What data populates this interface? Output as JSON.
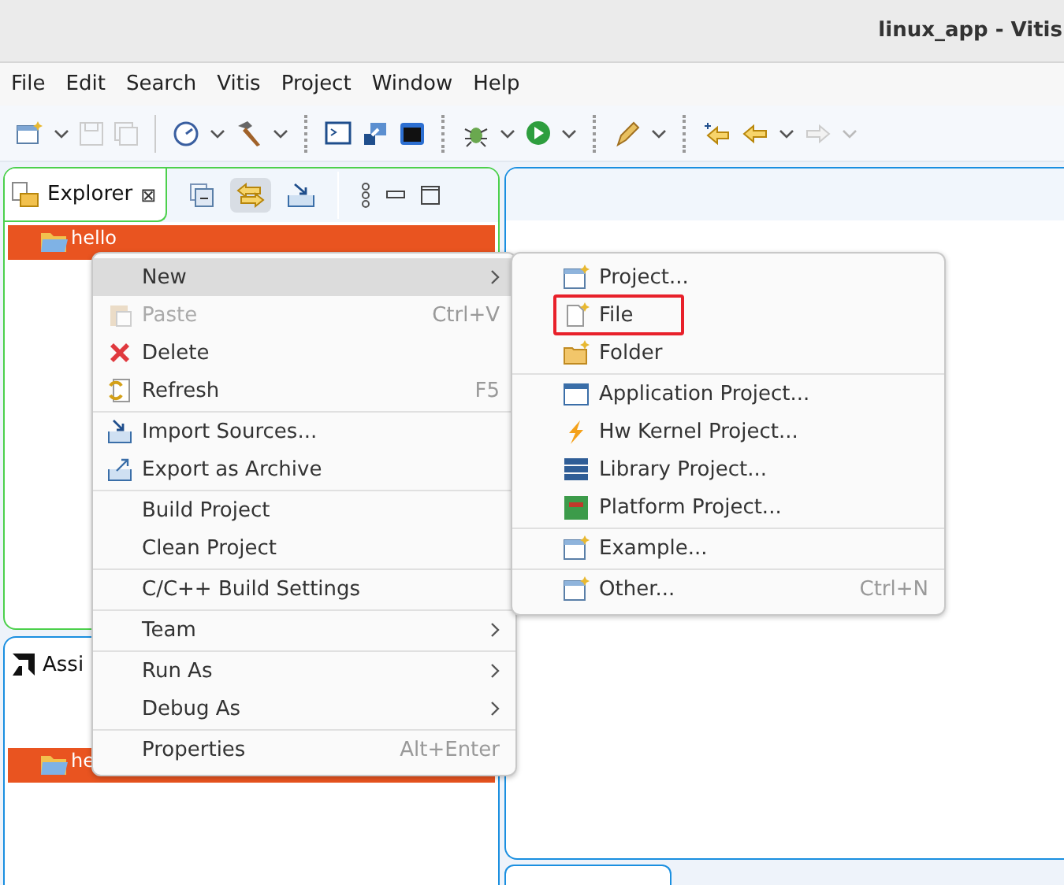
{
  "window": {
    "title": "linux_app - Vitis"
  },
  "menubar": [
    "File",
    "Edit",
    "Search",
    "Vitis",
    "Project",
    "Window",
    "Help"
  ],
  "explorer": {
    "tab": "Explorer",
    "close": "⊠",
    "rows": [
      {
        "label": "hello",
        "selected": true
      }
    ]
  },
  "assistant": {
    "tab": "Assi",
    "rows": [
      {
        "label": "he",
        "selected": true
      }
    ]
  },
  "context_menu": {
    "groups": [
      [
        {
          "label": "New",
          "submenu": true,
          "selected": true,
          "disabled": false
        },
        {
          "label": "Paste",
          "shortcut": "Ctrl+V",
          "selected": false,
          "disabled": true
        },
        {
          "label": "Delete",
          "selected": false,
          "disabled": false
        },
        {
          "label": "Refresh",
          "shortcut": "F5",
          "selected": false,
          "disabled": false
        }
      ],
      [
        {
          "label": "Import Sources...",
          "selected": false,
          "disabled": false
        },
        {
          "label": "Export as Archive",
          "selected": false,
          "disabled": false
        }
      ],
      [
        {
          "label": "Build Project",
          "selected": false,
          "disabled": false
        },
        {
          "label": "Clean Project",
          "selected": false,
          "disabled": false
        }
      ],
      [
        {
          "label": "C/C++ Build Settings",
          "selected": false,
          "disabled": false
        }
      ],
      [
        {
          "label": "Team",
          "submenu": true,
          "selected": false,
          "disabled": false
        }
      ],
      [
        {
          "label": "Run As",
          "submenu": true,
          "selected": false,
          "disabled": false
        },
        {
          "label": "Debug As",
          "submenu": true,
          "selected": false,
          "disabled": false
        }
      ],
      [
        {
          "label": "Properties",
          "shortcut": "Alt+Enter",
          "selected": false,
          "disabled": false
        }
      ]
    ]
  },
  "submenu": {
    "groups": [
      [
        {
          "label": "Project...",
          "marked": false
        },
        {
          "label": "File",
          "marked": true
        },
        {
          "label": "Folder",
          "marked": false
        }
      ],
      [
        {
          "label": "Application Project...",
          "marked": false
        },
        {
          "label": "Hw Kernel Project...",
          "marked": false
        },
        {
          "label": "Library Project...",
          "marked": false
        },
        {
          "label": "Platform Project...",
          "marked": false
        }
      ],
      [
        {
          "label": "Example...",
          "marked": false
        }
      ],
      [
        {
          "label": "Other...",
          "shortcut": "Ctrl+N",
          "marked": false
        }
      ]
    ]
  }
}
